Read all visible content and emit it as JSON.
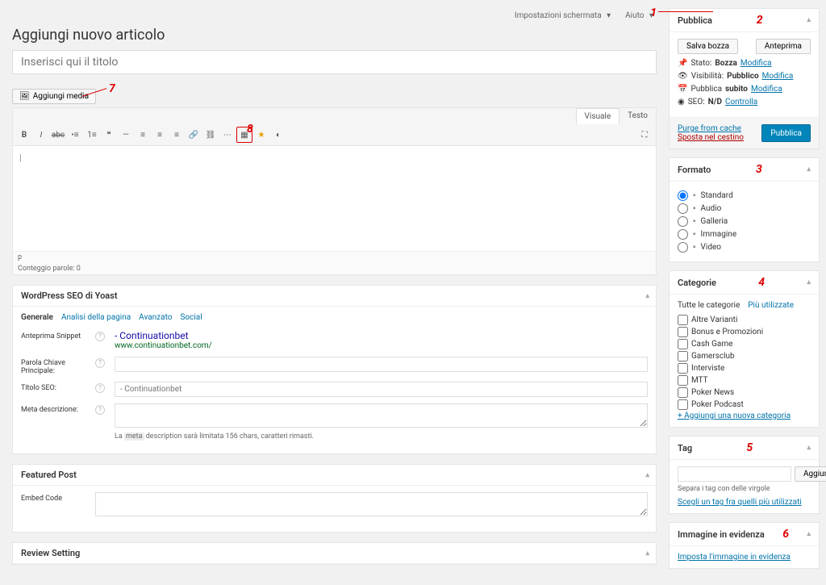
{
  "topbar": {
    "screen_options": "Impostazioni schermata",
    "help": "Aiuto"
  },
  "page": {
    "heading": "Aggiungi nuovo articolo",
    "title_placeholder": "Inserisci qui il titolo"
  },
  "media": {
    "add": "Aggiungi media"
  },
  "editor": {
    "tab_visual": "Visuale",
    "tab_text": "Testo",
    "status_path": "p",
    "word_count": "Conteggio parole: 0",
    "cursor": "|"
  },
  "seo": {
    "box_title": "WordPress SEO di Yoast",
    "tabs": {
      "general": "Generale",
      "page_analysis": "Analisi della pagina",
      "advanced": "Avanzato",
      "social": "Social"
    },
    "snippet_label": "Anteprima Snippet",
    "snippet_site": "- Continuationbet",
    "snippet_url": "www.continuationbet.com/",
    "keyword_label": "Parola Chiave Principale:",
    "title_label": "Titolo SEO:",
    "title_placeholder": "- Continuationbet",
    "meta_label": "Meta descrizione:",
    "meta_hint_pre": "La ",
    "meta_hint_code": "meta",
    "meta_hint_post": " description sarà limitata 156 chars, caratteri rimasti."
  },
  "featured_post": {
    "title": "Featured Post",
    "embed_label": "Embed Code"
  },
  "review": {
    "title": "Review Setting"
  },
  "publish": {
    "title": "Pubblica",
    "save_draft": "Salva bozza",
    "preview": "Anteprima",
    "status_label": "Stato:",
    "status_value": "Bozza",
    "edit": "Modifica",
    "visibility_label": "Visibilità:",
    "visibility_value": "Pubblico",
    "publish_label": "Pubblica",
    "publish_value": "subito",
    "seo_label": "SEO:",
    "seo_value": "N/D",
    "seo_check": "Controlla",
    "purge": "Purge from cache",
    "trash": "Sposta nel cestino",
    "submit": "Pubblica"
  },
  "format": {
    "title": "Formato",
    "items": [
      {
        "name": "Standard",
        "checked": true,
        "icon": "pin"
      },
      {
        "name": "Audio",
        "checked": false,
        "icon": "audio"
      },
      {
        "name": "Galleria",
        "checked": false,
        "icon": "gallery"
      },
      {
        "name": "Immagine",
        "checked": false,
        "icon": "image"
      },
      {
        "name": "Video",
        "checked": false,
        "icon": "video"
      }
    ]
  },
  "categories": {
    "title": "Categorie",
    "tab_all": "Tutte le categorie",
    "tab_most": "Più utilizzate",
    "items": [
      "Altre Varianti",
      "Bonus e Promozioni",
      "Cash Game",
      "Gamersclub",
      "Interviste",
      "MTT",
      "Poker News",
      "Poker Podcast"
    ],
    "add_new": "+ Aggiungi una nuova categoria"
  },
  "tags": {
    "title": "Tag",
    "add": "Aggiungi",
    "hint": "Separa i tag con delle virgole",
    "choose": "Scegli un tag fra quelli più utilizzati"
  },
  "featured_image": {
    "title": "Immagine in evidenza",
    "set": "Imposta l'immagine in evidenza"
  },
  "annotations": {
    "n1": "1",
    "n2": "2",
    "n3": "3",
    "n4": "4",
    "n5": "5",
    "n6": "6",
    "n7": "7",
    "n8": "8"
  }
}
